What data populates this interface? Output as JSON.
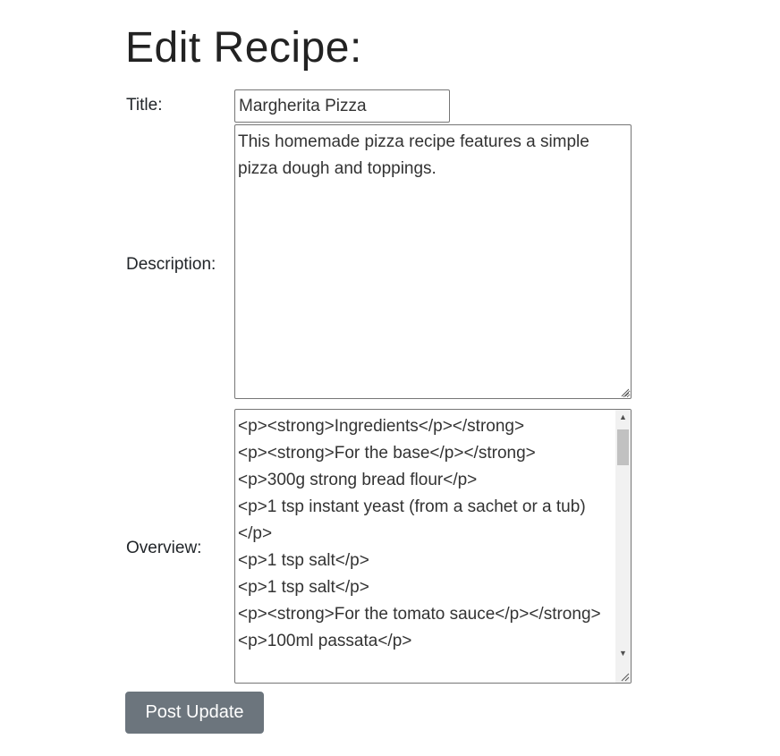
{
  "page": {
    "heading": "Edit Recipe:"
  },
  "form": {
    "title_label": "Title:",
    "title_value": "Margherita Pizza",
    "description_label": "Description:",
    "description_value": "This homemade pizza recipe features a simple pizza dough and toppings.",
    "overview_label": "Overview:",
    "overview_lines": [
      "<p><strong>Ingredients</p></strong>",
      "<p><strong>For the base</p></strong>",
      "<p>300g strong bread flour</p>",
      "<p>1 tsp instant yeast (from a sachet or a tub)</p>",
      "<p>1 tsp salt</p>",
      "<p>1 tsp salt</p>",
      "<p><strong>For the tomato sauce</p></strong>",
      "<p>100ml passata</p>"
    ],
    "submit_label": "Post Update"
  },
  "icons": {
    "scroll_up": "scroll-up-arrow-icon",
    "scroll_down": "scroll-down-arrow-icon",
    "resize": "resize-grip-icon"
  },
  "colors": {
    "button_bg": "#6c757d",
    "input_border": "#767676"
  }
}
